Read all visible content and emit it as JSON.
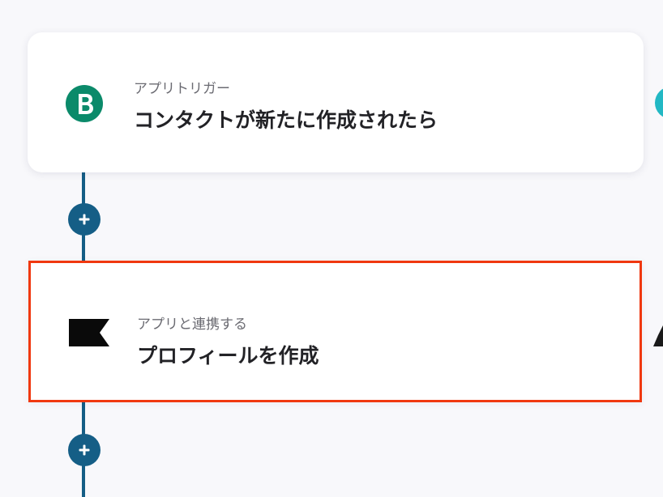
{
  "colors": {
    "connector": "#155e86",
    "highlight_border": "#f0380f",
    "trigger_icon_bg": "#0b8a6a",
    "background": "#f8f8fb"
  },
  "steps": [
    {
      "type_label": "アプリトリガー",
      "title": "コンタクトが新たに作成されたら",
      "icon": "brevo-b-icon"
    },
    {
      "type_label": "アプリと連携する",
      "title": "プロフィールを作成",
      "icon": "black-flag-icon"
    }
  ],
  "add_buttons": [
    {
      "icon": "plus-icon"
    },
    {
      "icon": "plus-icon"
    }
  ]
}
